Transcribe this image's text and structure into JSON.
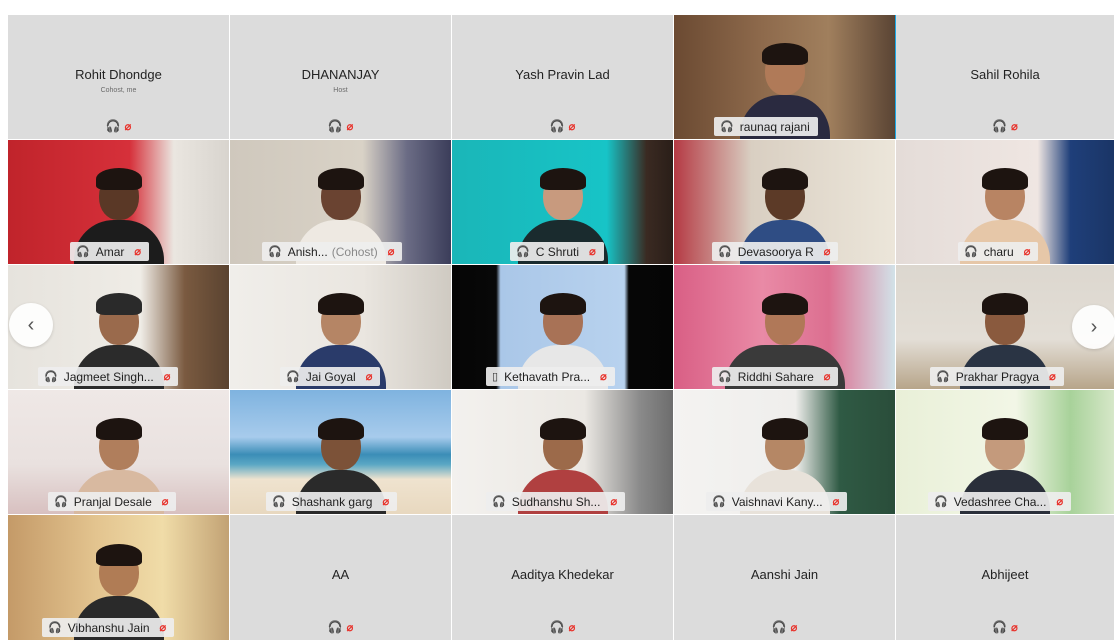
{
  "gallery": {
    "row1": [
      {
        "name": "Rohit Dhondge",
        "role": "Cohost, me",
        "video": false
      },
      {
        "name": "DHANANJAY",
        "role": "Host",
        "video": false
      },
      {
        "name": "Yash Pravin Lad",
        "role": "",
        "video": false
      },
      {
        "name": "raunaq rajani",
        "video": true,
        "active": true
      },
      {
        "name": "Sahil Rohila",
        "role": "",
        "video": false
      }
    ],
    "row2": [
      {
        "name": "Amar",
        "video": true
      },
      {
        "name": "Anish...",
        "suffix": "(Cohost)",
        "video": true
      },
      {
        "name": "C Shruti",
        "video": true
      },
      {
        "name": "Devasoorya R",
        "video": true
      },
      {
        "name": "charu",
        "video": true
      }
    ],
    "row3": [
      {
        "name": "Jagmeet Singh...",
        "video": true
      },
      {
        "name": "Jai Goyal",
        "video": true
      },
      {
        "name": "Kethavath Pra...",
        "video": true,
        "device": "phone"
      },
      {
        "name": "Riddhi Sahare",
        "video": true
      },
      {
        "name": "Prakhar Pragya",
        "video": true
      }
    ],
    "row4": [
      {
        "name": "Pranjal Desale",
        "video": true
      },
      {
        "name": "Shashank garg",
        "video": true
      },
      {
        "name": "Sudhanshu Sh...",
        "video": true
      },
      {
        "name": "Vaishnavi Kany...",
        "video": true
      },
      {
        "name": "Vedashree Cha...",
        "video": true
      }
    ],
    "row5": [
      {
        "name": "Vibhanshu Jain",
        "video": true
      },
      {
        "name": "AA",
        "video": false
      },
      {
        "name": "Aaditya Khedekar",
        "video": false
      },
      {
        "name": "Aanshi Jain",
        "video": false
      },
      {
        "name": "Abhijeet",
        "video": false
      }
    ]
  },
  "icons": {
    "headset": "headset-icon",
    "mic_off": "mic-off-icon",
    "phone": "phone-icon",
    "prev": "chevron-left-icon",
    "next": "chevron-right-icon"
  },
  "nav": {
    "prev_label": "‹",
    "next_label": "›"
  },
  "colors": {
    "active_border": "#19a8e6",
    "mic_off": "#e8322b",
    "tile_bg": "#dcdcdc"
  }
}
